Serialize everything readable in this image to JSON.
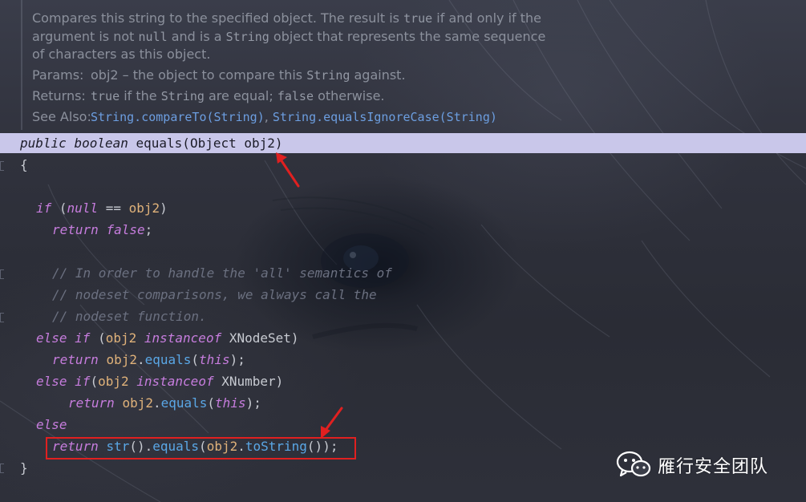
{
  "doc": {
    "line1_pre": "Compares this string to the specified object. The result is ",
    "line1_true": "true",
    "line1_post": " if and only if the",
    "line2_pre": "argument is not ",
    "line2_null": "null",
    "line2_mid": " and is a ",
    "line2_string": "String",
    "line2_post": " object that represents the same sequence",
    "line3": "of characters as this object.",
    "params_label": "Params:",
    "params_text_pre": "obj2 – the object to compare this ",
    "params_string": "String",
    "params_text_post": " against.",
    "returns_label": "Returns:",
    "returns_true": "true",
    "returns_mid": " if the ",
    "returns_string": "String",
    "returns_mid2": "  are equal; ",
    "returns_false": "false",
    "returns_post": " otherwise.",
    "see_label": "See Also:",
    "see_link1": "String.compareTo(String)",
    "see_sep": ", ",
    "see_link2": "String.equalsIgnoreCase(String)"
  },
  "code": {
    "sig_kw1": "public",
    "sig_kw2": "boolean",
    "sig_rest": " equals(Object obj2)",
    "open_brace": "{",
    "if_kw": "if",
    "if_open": " (",
    "null_kw": "null",
    "if_eq": " == ",
    "obj2": "obj2",
    "close_paren": ")",
    "return_kw": "return",
    "false_kw": "false",
    "semi": ";",
    "comment1": "// In order to handle the 'all' semantics of",
    "comment2": "// nodeset comparisons, we always call the",
    "comment3": "// nodeset function.",
    "else_kw": "else",
    "instanceof_kw": "instanceof",
    "xnodeset": " XNodeSet)",
    "xnumber": " XNumber)",
    "equals_fn": "equals",
    "this_kw": "this",
    "str_fn": "str",
    "tostring_fn": "toString",
    "close_brace": "}"
  },
  "watermark": {
    "text": "雁行安全团队",
    "icon": "wechat-icon"
  },
  "colors": {
    "highlight": "#c9c7ea",
    "keyword": "#c77dde",
    "variable": "#e0b27a",
    "function": "#5aa7e6",
    "comment": "#6b7080",
    "annotation_red": "#e02020"
  }
}
